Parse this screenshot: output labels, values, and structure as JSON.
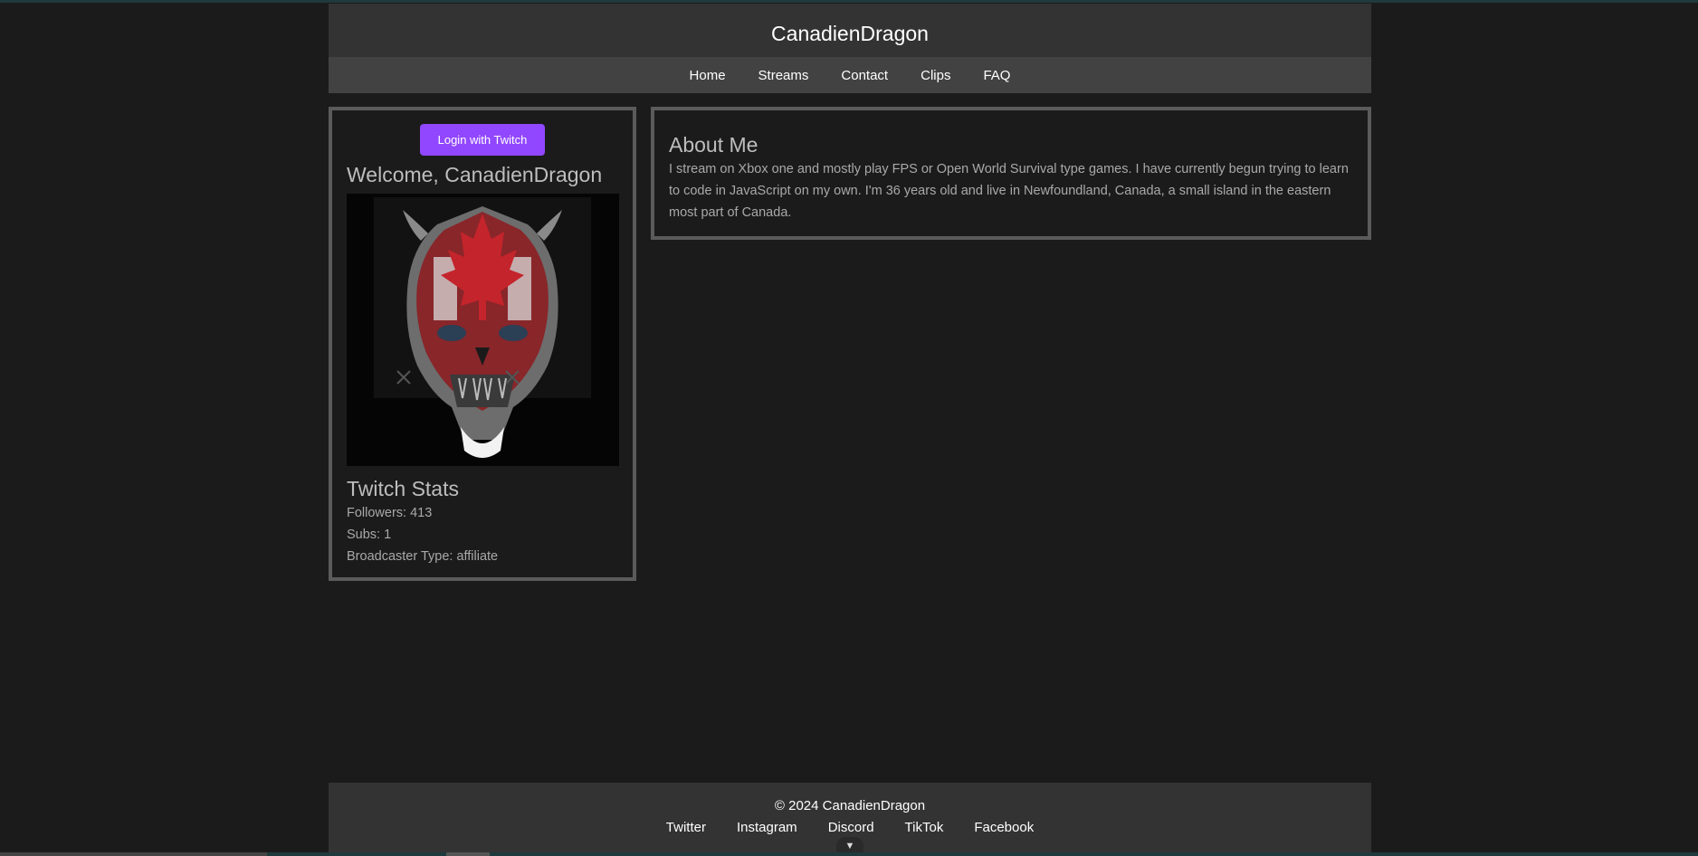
{
  "site": {
    "title": "CanadienDragon"
  },
  "nav": {
    "items": [
      {
        "label": "Home"
      },
      {
        "label": "Streams"
      },
      {
        "label": "Contact"
      },
      {
        "label": "Clips"
      },
      {
        "label": "FAQ"
      }
    ]
  },
  "profile": {
    "login_label": "Login with Twitch",
    "welcome": "Welcome, CanadienDragon",
    "stats_title": "Twitch Stats",
    "followers": "Followers: 413",
    "subs": "Subs: 1",
    "broadcaster_type": "Broadcaster Type: affiliate",
    "accent_color": "#9147ff"
  },
  "about": {
    "title": "About Me",
    "text": "I stream on Xbox one and mostly play FPS or Open World Survival type games. I have currently begun trying to learn to code in JavaScript on my own. I'm 36 years old and live in Newfoundland, Canada, a small island in the eastern most part of Canada."
  },
  "footer": {
    "copyright": "© 2024 CanadienDragon",
    "links": [
      {
        "label": "Twitter"
      },
      {
        "label": "Instagram"
      },
      {
        "label": "Discord"
      },
      {
        "label": "TikTok"
      },
      {
        "label": "Facebook"
      }
    ]
  },
  "icons": {
    "scroll": "chevron-down-icon"
  }
}
